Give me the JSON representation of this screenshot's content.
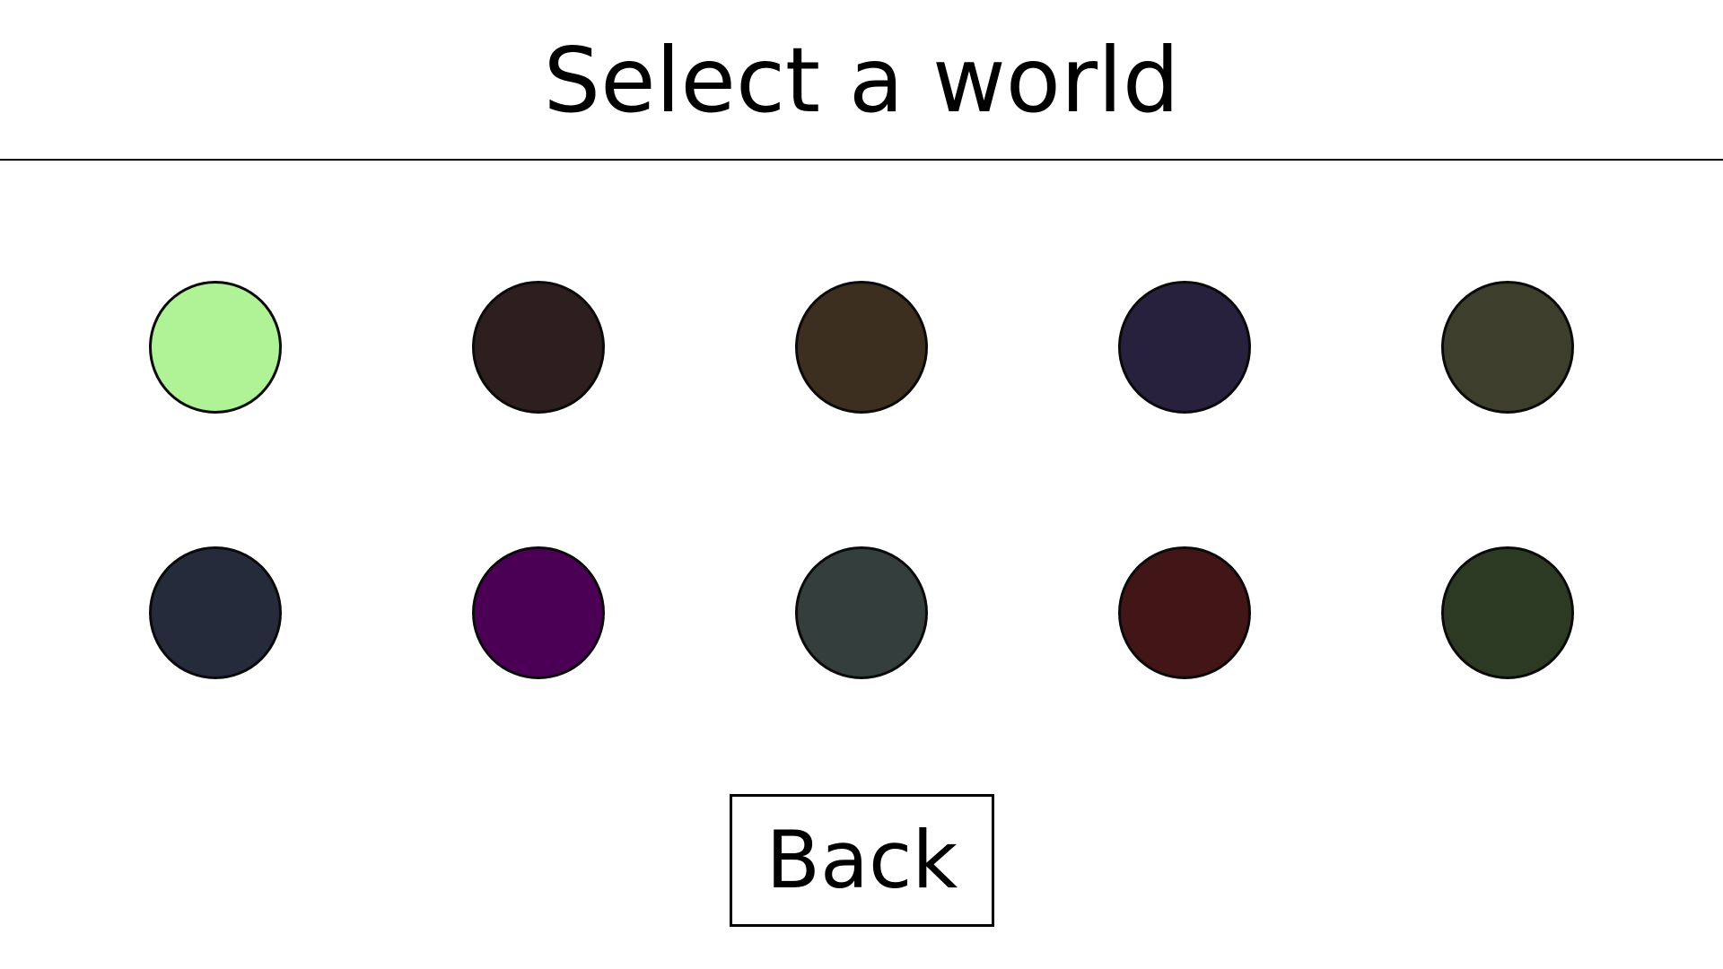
{
  "title": "Select a world",
  "worlds": [
    {
      "color": "#b0f296",
      "row": 1,
      "col": 1
    },
    {
      "color": "#2c1f1d",
      "row": 1,
      "col": 2
    },
    {
      "color": "#3c2f1f",
      "row": 1,
      "col": 3
    },
    {
      "color": "#27213e",
      "row": 1,
      "col": 4
    },
    {
      "color": "#3d3f2c",
      "row": 1,
      "col": 5
    },
    {
      "color": "#262b3c",
      "row": 2,
      "col": 1
    },
    {
      "color": "#4b0056",
      "row": 2,
      "col": 2
    },
    {
      "color": "#343f3d",
      "row": 2,
      "col": 3
    },
    {
      "color": "#421516",
      "row": 2,
      "col": 4
    },
    {
      "color": "#2c3a24",
      "row": 2,
      "col": 5
    }
  ],
  "back_label": "Back"
}
